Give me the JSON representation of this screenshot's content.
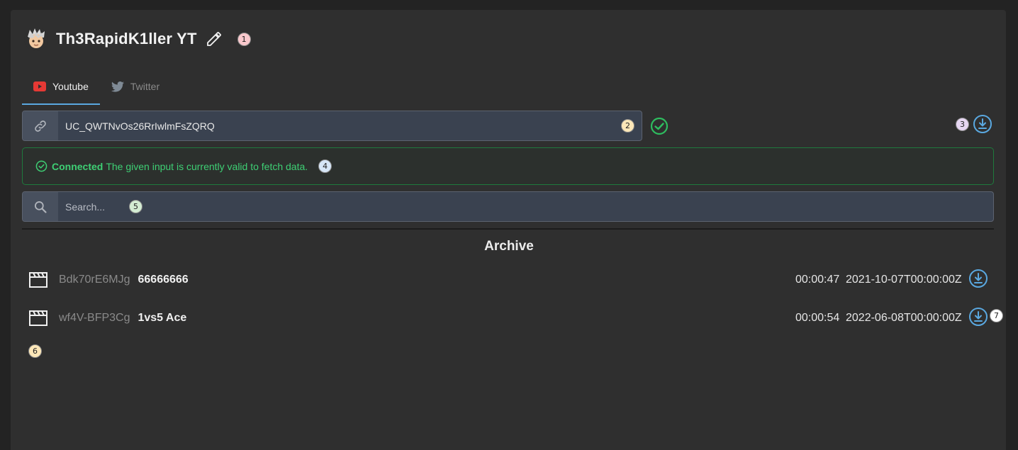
{
  "header": {
    "title": "Th3RapidK1ller YT",
    "badge": "1"
  },
  "tabs": [
    {
      "label": "Youtube",
      "active": true
    },
    {
      "label": "Twitter",
      "active": false
    }
  ],
  "channel_input": {
    "value": "UC_QWTNvOs26RrIwlmFsZQRQ",
    "badge": "2"
  },
  "download_all": {
    "badge": "3"
  },
  "alert": {
    "strong": "Connected",
    "message": "The given input is currently valid to fetch data.",
    "badge": "4"
  },
  "search": {
    "placeholder": "Search...",
    "badge": "5"
  },
  "archive": {
    "title": "Archive",
    "rows": [
      {
        "id": "Bdk70rE6MJg",
        "name": "66666666",
        "duration": "00:00:47",
        "date": "2021-10-07T00:00:00Z"
      },
      {
        "id": "wf4V-BFP3Cg",
        "name": "1vs5 Ace",
        "duration": "00:00:54",
        "date": "2022-06-08T00:00:00Z"
      }
    ],
    "list_badge": "6",
    "row_badge": "7"
  },
  "colors": {
    "accent": "#5aa8e0",
    "success": "#3ecf74",
    "youtube": "#e53935",
    "input_bg": "#3a4250"
  }
}
